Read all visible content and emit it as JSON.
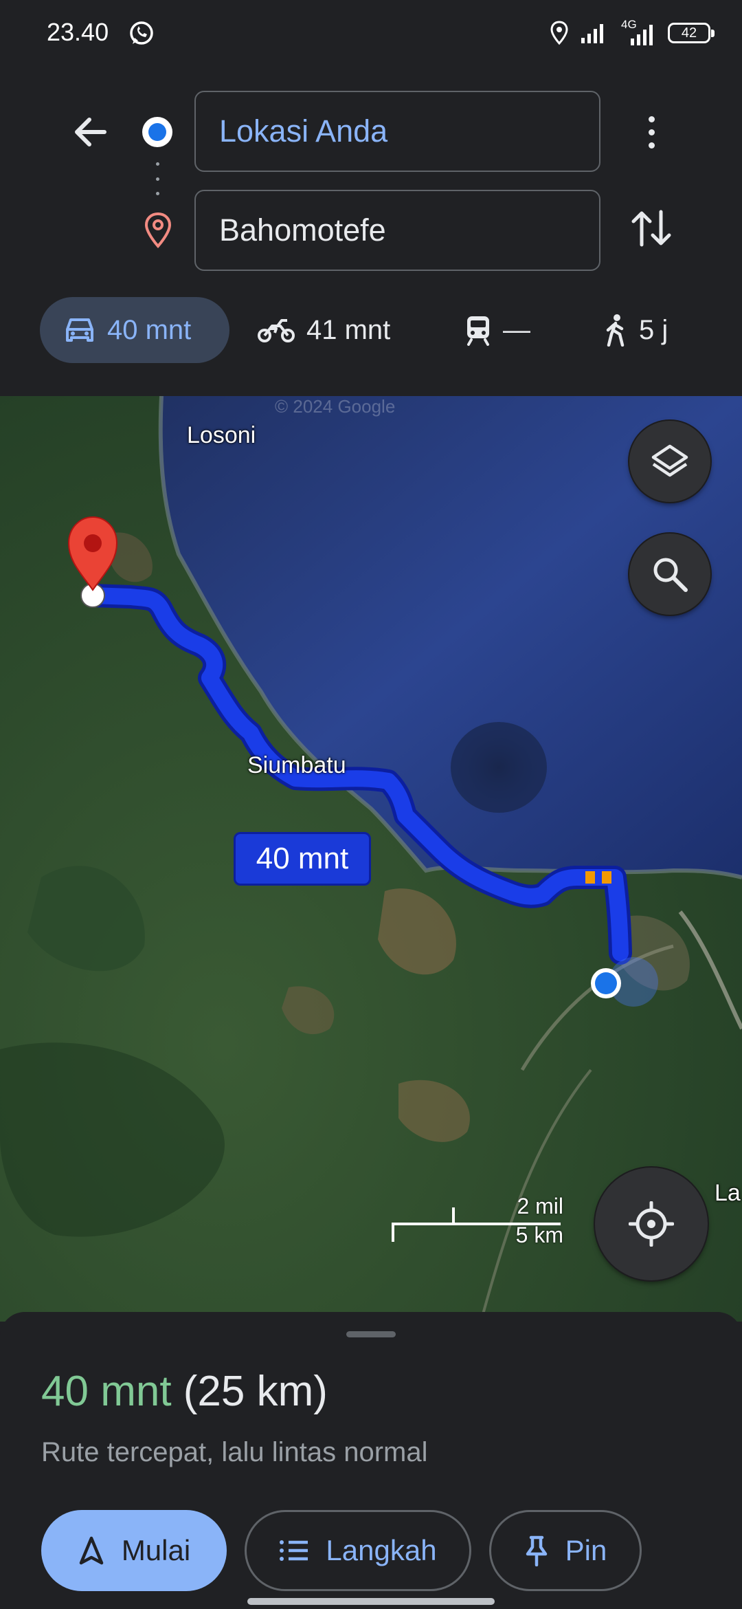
{
  "status_bar": {
    "time": "23.40",
    "network": "4G",
    "battery": "42"
  },
  "directions": {
    "origin_value": "Lokasi Anda",
    "destination_value": "Bahomotefe"
  },
  "modes": [
    {
      "name": "car",
      "icon": "car-icon",
      "time": "40 mnt",
      "selected": true
    },
    {
      "name": "motorcycle",
      "icon": "motorcycle-icon",
      "time": "41 mnt"
    },
    {
      "name": "transit",
      "icon": "train-icon",
      "time": "—"
    },
    {
      "name": "walk",
      "icon": "walk-icon",
      "time": "5 j"
    }
  ],
  "map": {
    "watermark": "© 2024 Google",
    "labels": {
      "losoni": "Losoni",
      "siumbatu": "Siumbatu",
      "edge": "La"
    },
    "route_eta": "40 mnt",
    "scale_top": "2 mil",
    "scale_bottom": "5 km",
    "route_color": "#1a3de8",
    "traffic_color": "#f29900"
  },
  "sheet": {
    "time": "40 mnt",
    "distance": "(25 km)",
    "subtitle": "Rute tercepat, lalu lintas normal",
    "buttons": {
      "start": "Mulai",
      "steps": "Langkah",
      "pin": "Pin"
    }
  },
  "colors": {
    "accent": "#8ab4f8",
    "eta_green": "#81c995",
    "background": "#202124"
  }
}
